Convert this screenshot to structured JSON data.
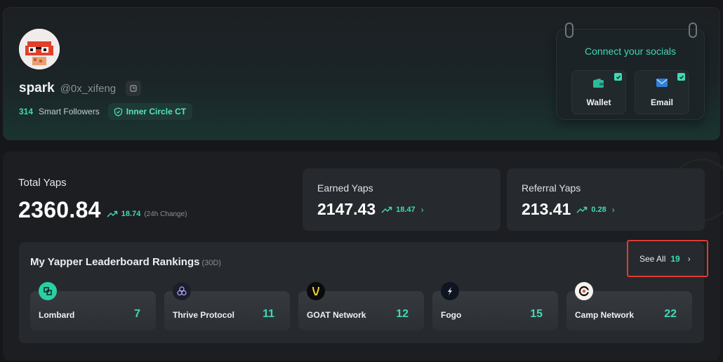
{
  "profile": {
    "display_name": "spark",
    "handle": "@0x_xifeng",
    "smart_followers_count": "314",
    "smart_followers_label": "Smart Followers",
    "badge_label": "Inner Circle CT"
  },
  "socials": {
    "title": "Connect your socials",
    "buttons": [
      {
        "label": "Wallet",
        "icon": "wallet-icon",
        "connected": true
      },
      {
        "label": "Email",
        "icon": "mail-icon",
        "connected": true
      }
    ]
  },
  "stats": {
    "total": {
      "label": "Total Yaps",
      "value": "2360.84",
      "change": "18.74",
      "change_note": "(24h Change)"
    },
    "earned": {
      "label": "Earned Yaps",
      "value": "2147.43",
      "change": "18.47"
    },
    "referral": {
      "label": "Referral Yaps",
      "value": "213.41",
      "change": "0.28"
    }
  },
  "leaderboard": {
    "title": "My Yapper Leaderboard Rankings",
    "period": "(30D)",
    "see_all_label": "See All",
    "see_all_count": "19",
    "projects": [
      {
        "name": "Lombard",
        "rank": "7",
        "icon": "lombard-logo-icon"
      },
      {
        "name": "Thrive Protocol",
        "rank": "11",
        "icon": "thrive-logo-icon"
      },
      {
        "name": "GOAT Network",
        "rank": "12",
        "icon": "goat-logo-icon"
      },
      {
        "name": "Fogo",
        "rank": "15",
        "icon": "fogo-logo-icon"
      },
      {
        "name": "Camp Network",
        "rank": "22",
        "icon": "camp-logo-icon"
      }
    ]
  },
  "colors": {
    "accent": "#3fd9b6",
    "highlight_border": "#e03a32"
  }
}
